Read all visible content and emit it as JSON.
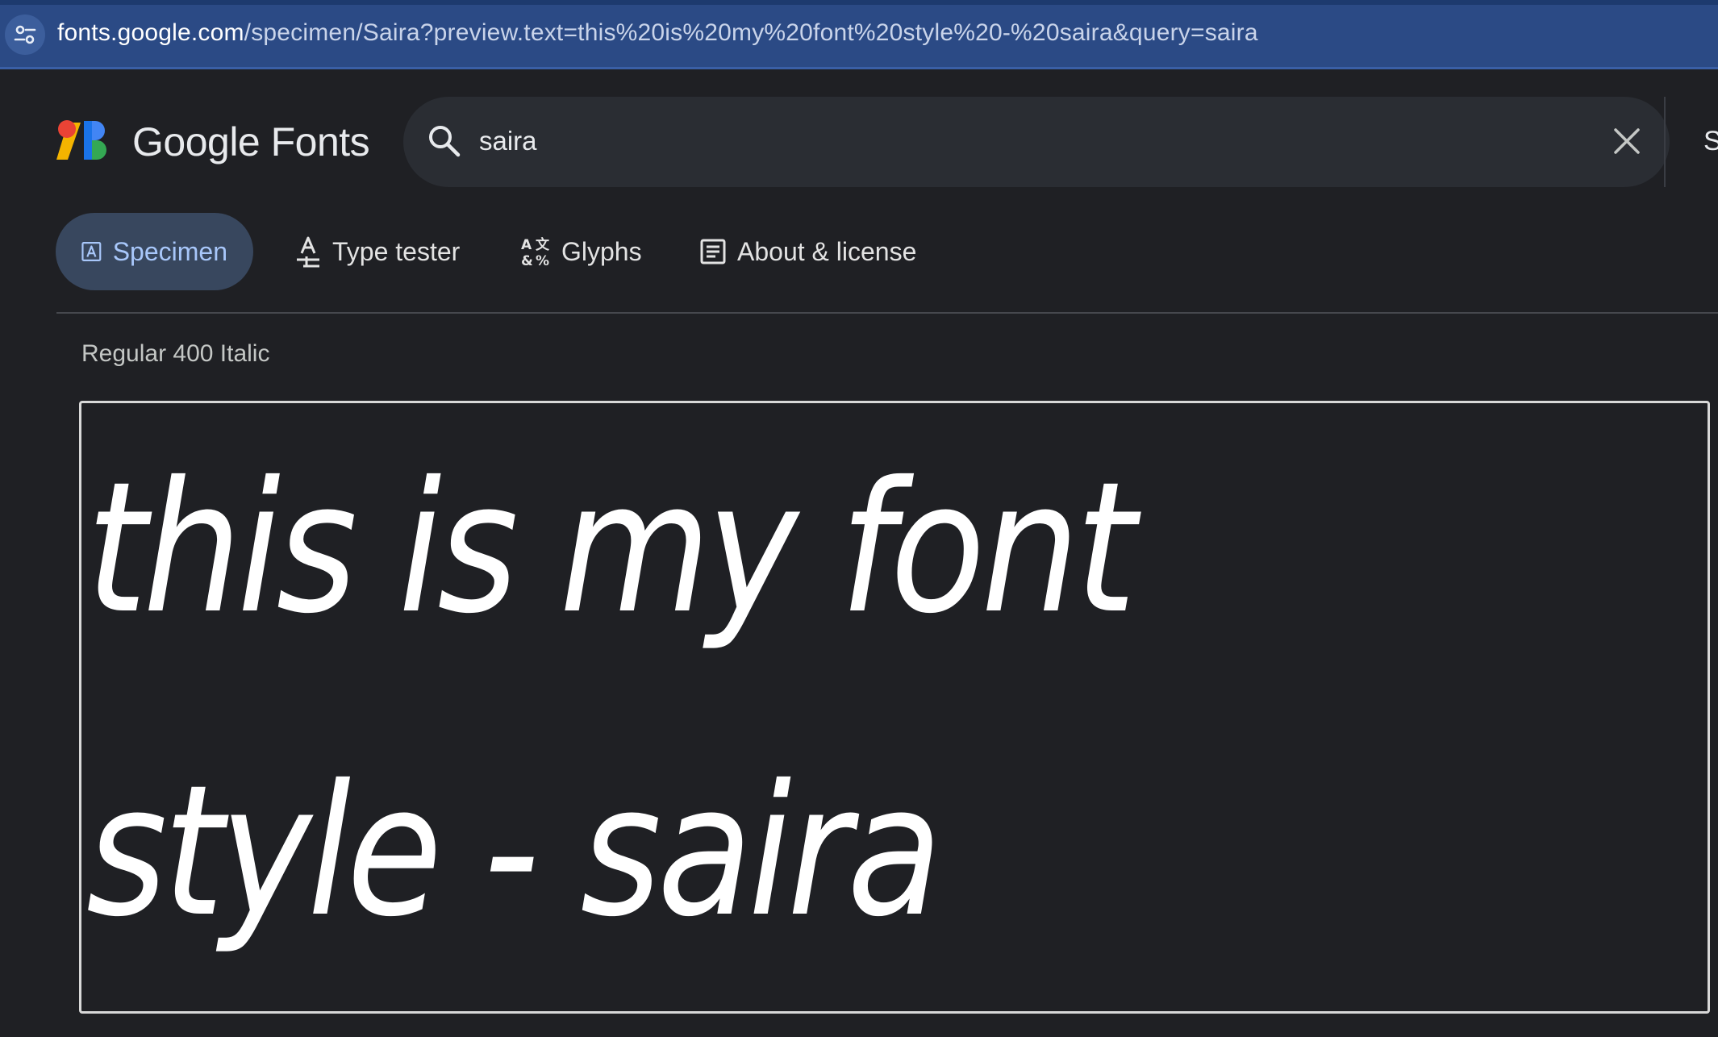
{
  "browser": {
    "url_host": "fonts.google.com",
    "url_path": "/specimen/Saira?preview.text=this%20is%20my%20font%20style%20-%20saira&query=saira"
  },
  "header": {
    "brand": "Google Fonts",
    "search": {
      "value": "saira",
      "placeholder": ""
    },
    "cut_button_label": "S"
  },
  "tabs": [
    {
      "label": "Specimen",
      "icon": "specimen-icon",
      "active": true
    },
    {
      "label": "Type tester",
      "icon": "type-tester-icon",
      "active": false
    },
    {
      "label": "Glyphs",
      "icon": "glyphs-icon",
      "active": false
    },
    {
      "label": "About & license",
      "icon": "article-icon",
      "active": false
    }
  ],
  "style_section": {
    "style_name": "Regular 400 Italic",
    "preview_text": "this is my font style - saira"
  },
  "colors": {
    "background": "#1f2024",
    "active_tab_bg": "#38475e",
    "active_tab_text": "#a8c7fa",
    "address_bar": "#2b4a85"
  }
}
